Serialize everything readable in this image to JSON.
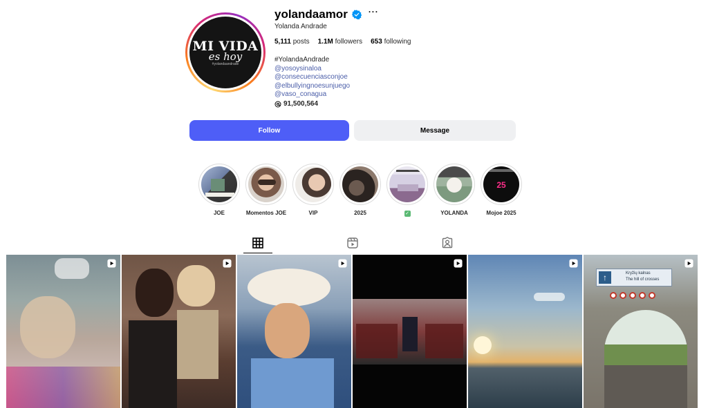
{
  "profile": {
    "username": "yolandaamor",
    "full_name": "Yolanda Andrade",
    "avatar_text": {
      "line1": "MI VIDA",
      "line2": "es hoy",
      "line3": "#yolandaandrade"
    },
    "stats": {
      "posts_value": "5,111",
      "posts_label": "posts",
      "followers_value": "1.1M",
      "followers_label": "followers",
      "following_value": "653",
      "following_label": "following"
    },
    "bio": {
      "hashtag": "#YolandaAndrade",
      "links": [
        "@yosoysinaloa",
        "@consecuenciasconjoe",
        "@elbullyingnoesunjuego",
        "@vaso_conagua"
      ],
      "threads_count": "91,500,564"
    },
    "verified_icon": "verified-badge-icon",
    "more_icon": "more-options-icon"
  },
  "buttons": {
    "follow": "Follow",
    "message": "Message"
  },
  "highlights": [
    {
      "label": "JOE",
      "icon": "highlight-cover"
    },
    {
      "label": "Momentos JOE",
      "icon": "highlight-cover"
    },
    {
      "label": "VIP",
      "icon": "highlight-cover"
    },
    {
      "label": "2025",
      "icon": "highlight-cover"
    },
    {
      "label": "✅",
      "icon": "check-emoji"
    },
    {
      "label": "YOLANDA",
      "icon": "highlight-cover"
    },
    {
      "label": "Mojoe 2025",
      "icon": "highlight-cover",
      "cover_text": "25"
    }
  ],
  "tabs": [
    {
      "name": "posts",
      "icon": "grid-icon",
      "active": true
    },
    {
      "name": "reels",
      "icon": "reels-icon",
      "active": false
    },
    {
      "name": "tagged",
      "icon": "tagged-icon",
      "active": false
    }
  ],
  "posts": [
    {
      "type": "reel",
      "icon": "reel-icon"
    },
    {
      "type": "reel",
      "icon": "reel-icon"
    },
    {
      "type": "reel",
      "icon": "reel-icon"
    },
    {
      "type": "reel",
      "icon": "reel-icon"
    },
    {
      "type": "reel",
      "icon": "reel-icon"
    },
    {
      "type": "reel",
      "icon": "reel-icon",
      "sign_text": {
        "line1": "Kryžių kalnas",
        "line2": "The hill of crosses"
      }
    }
  ],
  "colors": {
    "follow_button": "#4e5ef7",
    "message_button": "#eff0f2",
    "link": "#4a5da8",
    "verified": "#0095f6"
  }
}
